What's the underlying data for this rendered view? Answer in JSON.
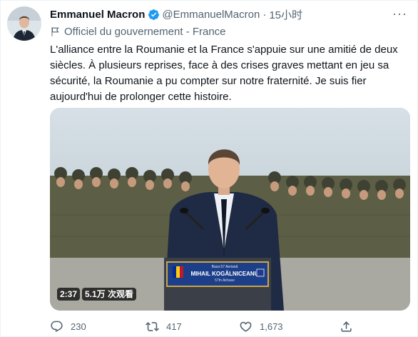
{
  "author": {
    "name": "Emmanuel Macron",
    "handle": "@EmmanuelMacron",
    "separator": "·",
    "time": "15小时",
    "affiliation": "Officiel du gouvernement - France"
  },
  "tweet": {
    "text": "L'alliance entre la Roumanie et la France s'appuie sur une amitié de deux siècles. À plusieurs reprises, face à des crises graves mettant en jeu sa sécurité, la Roumanie a pu compter sur notre fraternité. Je suis fier aujourd'hui de prolonger cette histoire."
  },
  "video": {
    "duration": "2:37",
    "views": "5.1万 次观看",
    "podium_small_text": "Baza 57 Aeriană",
    "podium_title": "MIHAIL KOGĂLNICEANU",
    "podium_sub": "57th Airbase"
  },
  "actions": {
    "replies": "230",
    "retweets": "417",
    "likes": "1,673"
  },
  "colors": {
    "verified": "#1d9bf0",
    "secondary_text": "#536471"
  },
  "icons": [
    "more-icon",
    "verified-badge-icon",
    "government-flag-icon",
    "reply-icon",
    "retweet-icon",
    "like-icon",
    "share-icon"
  ]
}
